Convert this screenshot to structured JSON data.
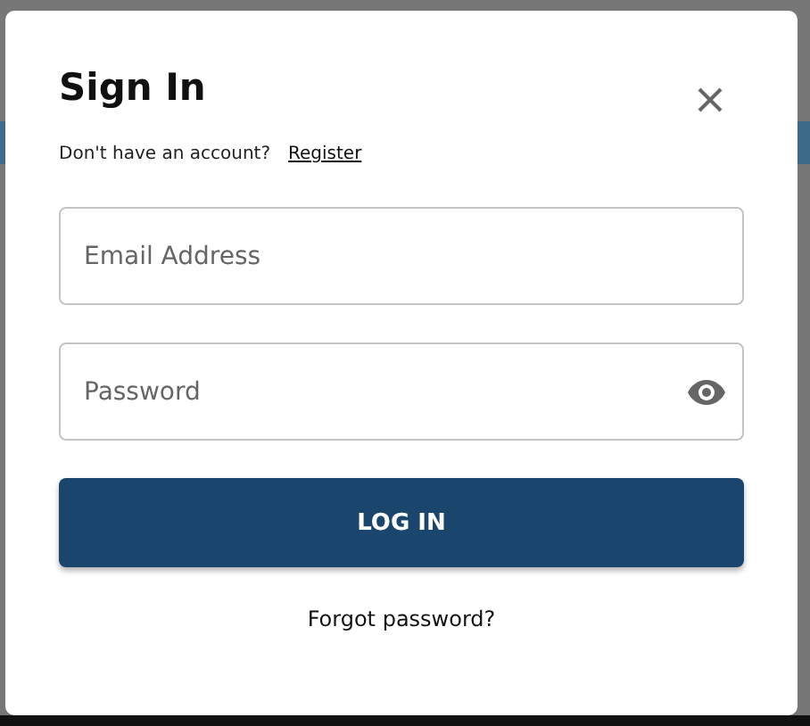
{
  "dialog": {
    "title": "Sign In",
    "subtitle": "Don't have an account?",
    "register_link": "Register"
  },
  "fields": [
    {
      "kind": "text",
      "placeholder": "Email Address"
    },
    {
      "kind": "password",
      "placeholder": "Password"
    }
  ],
  "login_button": "LOG IN",
  "forgot_link": "Forgot password?"
}
